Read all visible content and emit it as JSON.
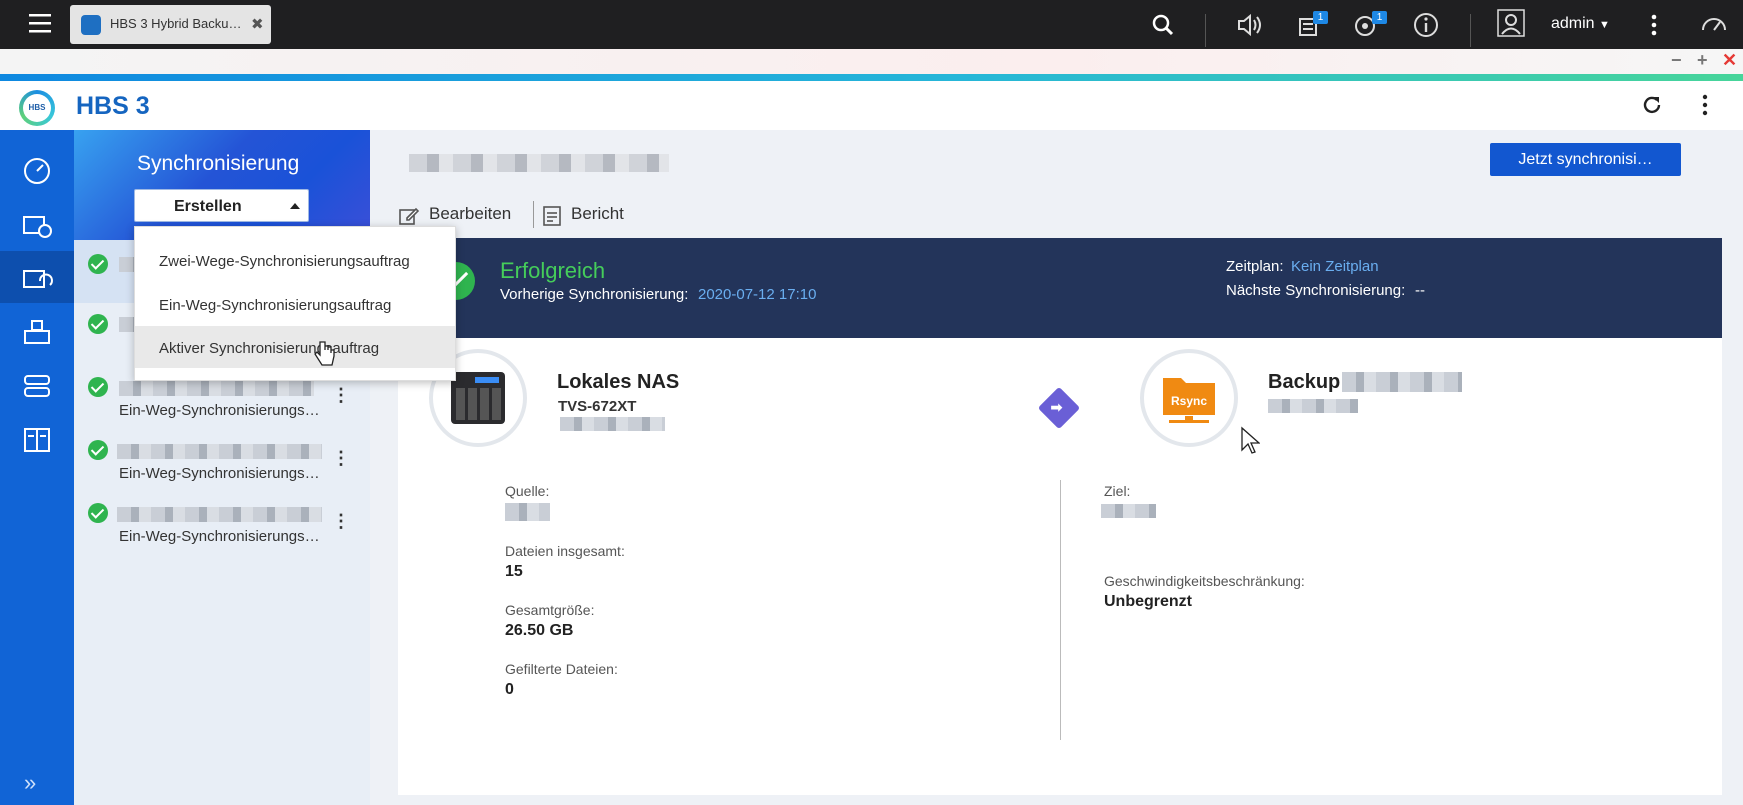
{
  "browser": {
    "tab_label": "HBS 3 Hybrid Backu…",
    "user": "admin",
    "notif_badge_1": "1",
    "notif_badge_2": "1"
  },
  "window_controls": {
    "minimize": "−",
    "maximize": "+",
    "close": "✕"
  },
  "app": {
    "title": "HBS 3",
    "logo_text": "HBS"
  },
  "nav": {
    "items": [
      "dashboard-icon",
      "backup-restore-icon",
      "sync-icon",
      "backup-versions-icon",
      "storage-icon",
      "logs-icon"
    ],
    "active_index": 2,
    "expand_icon": "»"
  },
  "sidebar": {
    "title": "Synchronisierung",
    "create_button": "Erstellen",
    "jobs": [
      {
        "status": "success",
        "description": ""
      },
      {
        "status": "success",
        "description": ""
      },
      {
        "status": "success",
        "description": "Ein-Weg-Synchronisierungsauftrag"
      },
      {
        "status": "success",
        "description": "Ein-Weg-Synchronisierungsauftrag"
      },
      {
        "status": "success",
        "description": "Ein-Weg-Synchronisierungsauftrag"
      }
    ]
  },
  "create_menu": {
    "items": [
      "Zwei-Wege-Synchronisierungsauftrag",
      "Ein-Weg-Synchronisierungsauftrag",
      "Aktiver Synchronisierungsauftrag"
    ],
    "hovered_index": 2
  },
  "main": {
    "sync_now_button": "Jetzt synchronisi…",
    "actions": {
      "edit": "Bearbeiten",
      "report": "Bericht"
    },
    "status": {
      "result": "Erfolgreich",
      "previous_label": "Vorherige Synchronisierung:",
      "previous_value": "2020-07-12 17:10",
      "schedule_label": "Zeitplan:",
      "schedule_value": "Kein Zeitplan",
      "next_label": "Nächste Synchronisierung:",
      "next_value": "--"
    },
    "source": {
      "title": "Lokales NAS",
      "model": "TVS-672XT"
    },
    "destination": {
      "title": "Backup",
      "icon_label": "Rsync"
    },
    "details": {
      "source_label": "Quelle:",
      "files_total_label": "Dateien insgesamt:",
      "files_total_value": "15",
      "total_size_label": "Gesamtgröße:",
      "total_size_value": "26.50 GB",
      "filtered_label": "Gefilterte Dateien:",
      "filtered_value": "0",
      "target_label": "Ziel:",
      "speed_label": "Geschwindigkeitsbeschränkung:",
      "speed_value": "Unbegrenzt"
    }
  }
}
